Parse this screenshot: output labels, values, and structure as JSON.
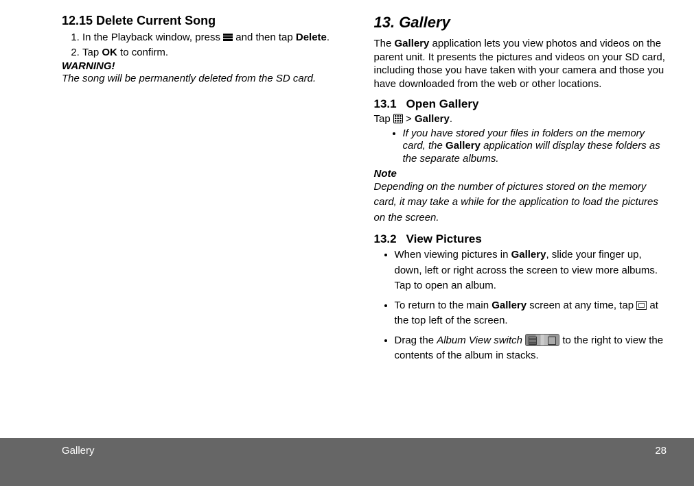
{
  "left": {
    "h": "12.15 Delete Current Song",
    "s1a": "In the Playback window, press ",
    "s1b": " and then tap ",
    "s1c": "Delete",
    "s1d": ".",
    "s2a": "Tap ",
    "s2b": "OK",
    "s2c": " to confirm.",
    "warn": "WARNING!",
    "warnline": "The song will be permanently deleted from the SD card."
  },
  "right": {
    "chap": "13. Gallery",
    "intro_a": "The ",
    "intro_b": "Gallery",
    "intro_c": " application lets you view photos and videos on the parent unit. It presents the pictures and videos on your SD card, including those you have taken with your camera and those you have downloaded from the web or other locations.",
    "s1num": "13.1",
    "s1title": "Open Gallery",
    "tap_a": "Tap ",
    "tap_b": " > ",
    "tap_c": "Gallery",
    "tap_d": ".",
    "bul1_a": "If you have stored your files in folders on the memory card, the ",
    "bul1_b": "Gallery",
    "bul1_c": " application will display these folders as the separate albums.",
    "note": "Note",
    "noteline": "Depending on the number of pictures stored on the memory card, it may take a while for the application to load the pictures on the screen.",
    "s2num": "13.2",
    "s2title": "View Pictures",
    "li1_a": "When viewing pictures in ",
    "li1_b": "Gallery",
    "li1_c": ", slide your finger up, down, left or right across the screen to view more albums. Tap to open an album.",
    "li2_a": "To return to the main ",
    "li2_b": "Gallery",
    "li2_c": " screen at any time, tap ",
    "li2_d": " at the top left of the screen.",
    "li3_a": "Drag the ",
    "li3_b": "Album View switch",
    "li3_c": "  to the right to view the contents of the album in stacks."
  },
  "footer": {
    "section": "Gallery",
    "page": "28"
  }
}
